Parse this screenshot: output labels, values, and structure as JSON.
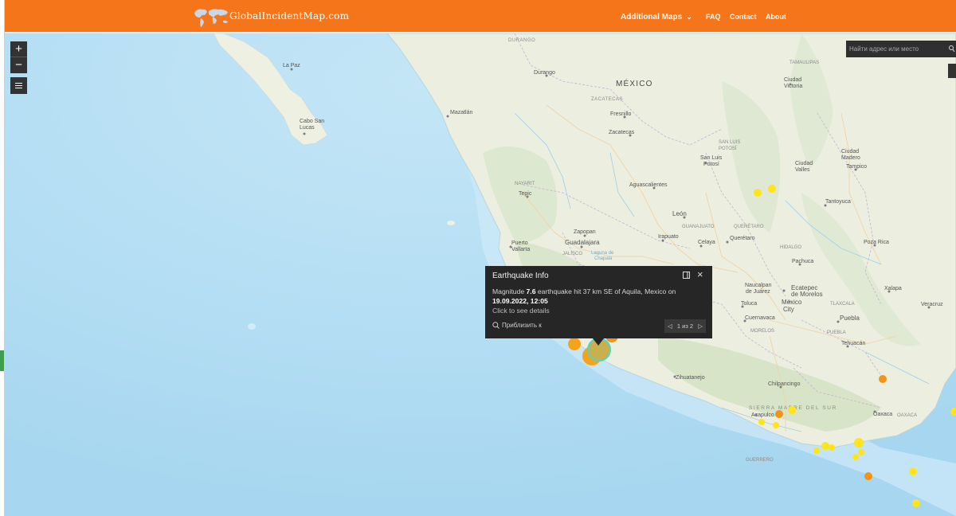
{
  "header": {
    "site_name": "GlobalIncidentMap.com",
    "nav": {
      "additional_maps": "Additional Maps",
      "faq": "FAQ",
      "contact": "Contact",
      "about": "About"
    },
    "colors": {
      "bar": "#f5761a",
      "text": "#ffffff"
    }
  },
  "map_controls": {
    "zoom_in": "+",
    "zoom_out": "−",
    "layers_icon": "list-icon"
  },
  "search": {
    "placeholder": "Найти адрес или место",
    "icon": "search-icon"
  },
  "map_labels": {
    "mexico": "MÉXICO",
    "durango_state": "DURANGO",
    "durango": "Durango",
    "la_paz": "La Paz",
    "cabo_san_lucas_1": "Cabo San",
    "cabo_san_lucas_2": "Lucas",
    "mazatlan": "Mazatlán",
    "zacatecas_state": "ZACATECAS",
    "fresnillo": "Fresnillo",
    "zacatecas": "Zacatecas",
    "slp_state_1": "SAN LUIS",
    "slp_state_2": "POTOSÍ",
    "slp_1": "San Luis",
    "slp_2": "Potosí",
    "nayarit": "NAYARIT",
    "tepic": "Tepic",
    "aguascalientes": "Aguascalientes",
    "leon": "León",
    "guanajuato": "GUANAJUATO",
    "queretaro_state": "QUERÉTARO",
    "zapopan": "Zapopan",
    "guadalajara": "Guadalajara",
    "irapuato": "Irapuato",
    "celaya": "Celaya",
    "queretaro": "Querétaro",
    "puerto_vallarta_1": "Puerto",
    "puerto_vallarta_2": "Vallarta",
    "jalisco": "JALISCO",
    "laguna_1": "Laguna de",
    "laguna_2": "Chapala",
    "hidalgo": "HIDALGO",
    "pachuca": "Pachuca",
    "tamaulipas": "TAMAULIPAS",
    "ciudad_victoria_1": "Ciudad",
    "ciudad_victoria_2": "Victoria",
    "ciudad_madero_1": "Ciudad",
    "ciudad_madero_2": "Madero",
    "tampico": "Tampico",
    "ciudad_valles_1": "Ciudad",
    "ciudad_valles_2": "Valles",
    "tantoyuca": "Tantoyuca",
    "poza_rica": "Poza Rica",
    "xalapa": "Xalapa",
    "veracruz": "Veracruz",
    "naucalpan_1": "Naucalpan",
    "naucalpan_2": "de Juárez",
    "ecatepec_1": "Ecatepec",
    "ecatepec_2": "de Morelos",
    "toluca": "Toluca",
    "mexico_city_1": "México",
    "mexico_city_2": "City",
    "tlaxcala": "TLAXCALA",
    "puebla": "Puebla",
    "puebla_state": "PUEBLA",
    "cuernavaca": "Cuernavaca",
    "morelos": "MORELOS",
    "tehuacan": "Tehuacán",
    "zihuatanejo": "Zihuatanejo",
    "chilpancingo": "Chilpancingo",
    "acapulco": "Acapulco",
    "sierra": "SIERRA   MADRE   DEL   SUR",
    "oaxaca": "Oaxaca",
    "oaxaca_state": "OAXACA",
    "guerrero": "GUERRERO"
  },
  "popup": {
    "title": "Earthquake Info",
    "body_prefix": "Magnitude ",
    "magnitude": "7.6",
    "body_middle": " earthquake hit 37 km SE of Aquila, Mexico on",
    "datetime": "19.09.2022, 12:05",
    "hint": "Click to see details",
    "zoom_to": "Приблизить к",
    "pager": "1 из 2"
  }
}
